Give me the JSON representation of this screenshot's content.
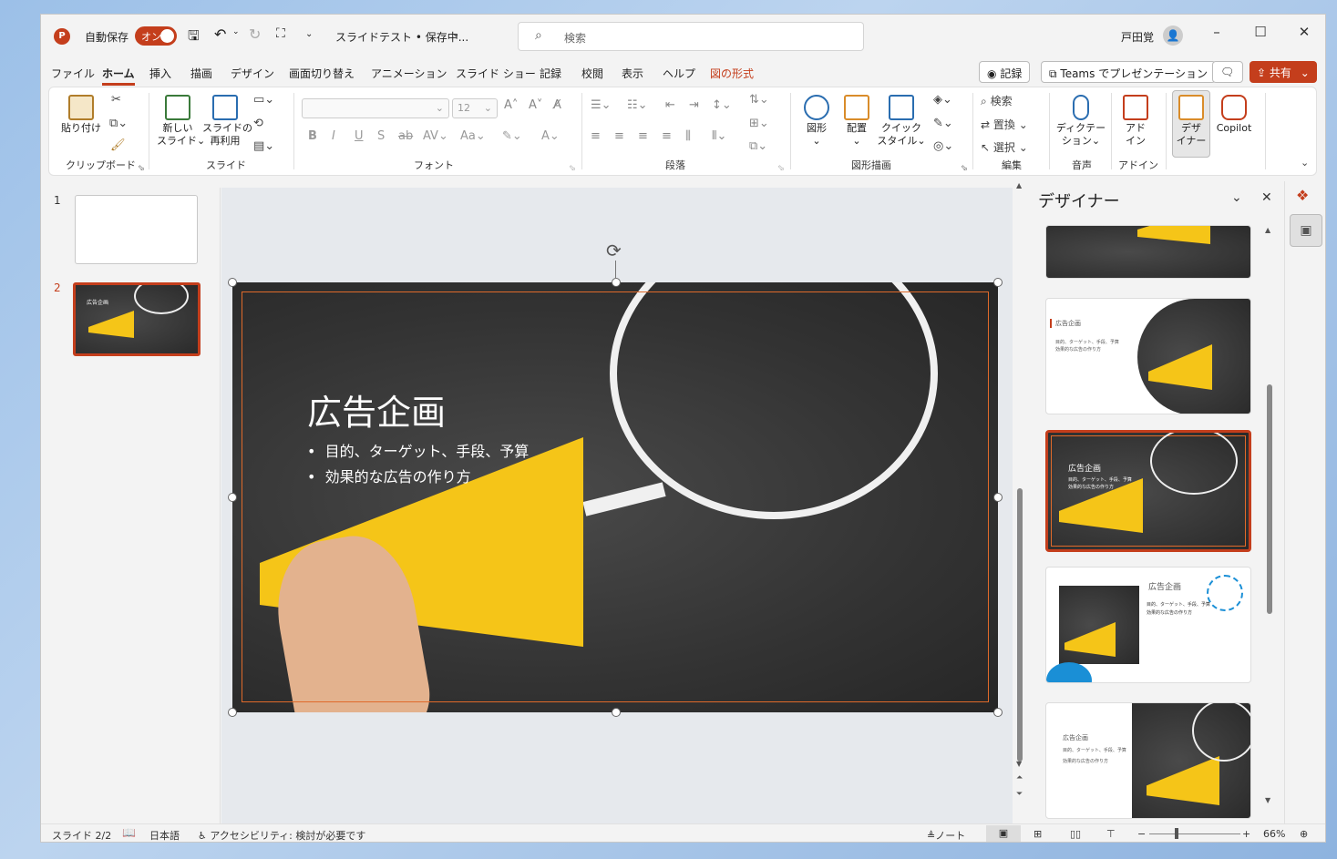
{
  "titlebar": {
    "autosave_label": "自動保存",
    "autosave_state": "オン",
    "filename": "スライドテスト • 保存中...",
    "search_placeholder": "検索",
    "user_name": "戸田覚"
  },
  "tabs": [
    "ファイル",
    "ホーム",
    "挿入",
    "描画",
    "デザイン",
    "画面切り替え",
    "アニメーション",
    "スライド ショー",
    "記録",
    "校閲",
    "表示",
    "ヘルプ",
    "図の形式"
  ],
  "actions": {
    "record": "記録",
    "teams": "Teams でプレゼンテーション",
    "share": "共有"
  },
  "ribbon": {
    "clipboard": {
      "paste": "貼り付け",
      "group": "クリップボード"
    },
    "slides": {
      "new_slide_1": "新しい",
      "new_slide_2": "スライド",
      "reuse_1": "スライドの",
      "reuse_2": "再利用",
      "group": "スライド"
    },
    "font": {
      "size": "12",
      "group": "フォント"
    },
    "paragraph": {
      "group": "段落"
    },
    "drawing": {
      "shapes": "図形",
      "arrange": "配置",
      "quick_1": "クイック",
      "quick_2": "スタイル",
      "group": "図形描画"
    },
    "editing": {
      "find": "検索",
      "replace": "置換",
      "select": "選択",
      "group": "編集"
    },
    "voice": {
      "dictate_1": "ディクテー",
      "dictate_2": "ション",
      "group": "音声"
    },
    "addins": {
      "addin_1": "アド",
      "addin_2": "イン",
      "group": "アドイン"
    },
    "designer_btn": {
      "l1": "デザ",
      "l2": "イナー"
    },
    "copilot": "Copilot"
  },
  "thumbnails": {
    "n1": "1",
    "n2": "2",
    "mini_title": "広告企画"
  },
  "slide": {
    "title": "広告企画",
    "bullets": [
      "目的、ターゲット、手段、予算",
      "効果的な広告の作り方"
    ]
  },
  "designer": {
    "title": "デザイナー",
    "card_title": "広告企画",
    "card_bullets": [
      "目的、ターゲット、手段、予算",
      "効果的な広告の作り方"
    ]
  },
  "status": {
    "slide": "スライド 2/2",
    "language": "日本語",
    "accessibility": "アクセシビリティ: 検討が必要です",
    "notes": "ノート",
    "zoom": "66%"
  },
  "colors": {
    "accent": "#c43e1c",
    "megaphone": "#f5c518"
  }
}
